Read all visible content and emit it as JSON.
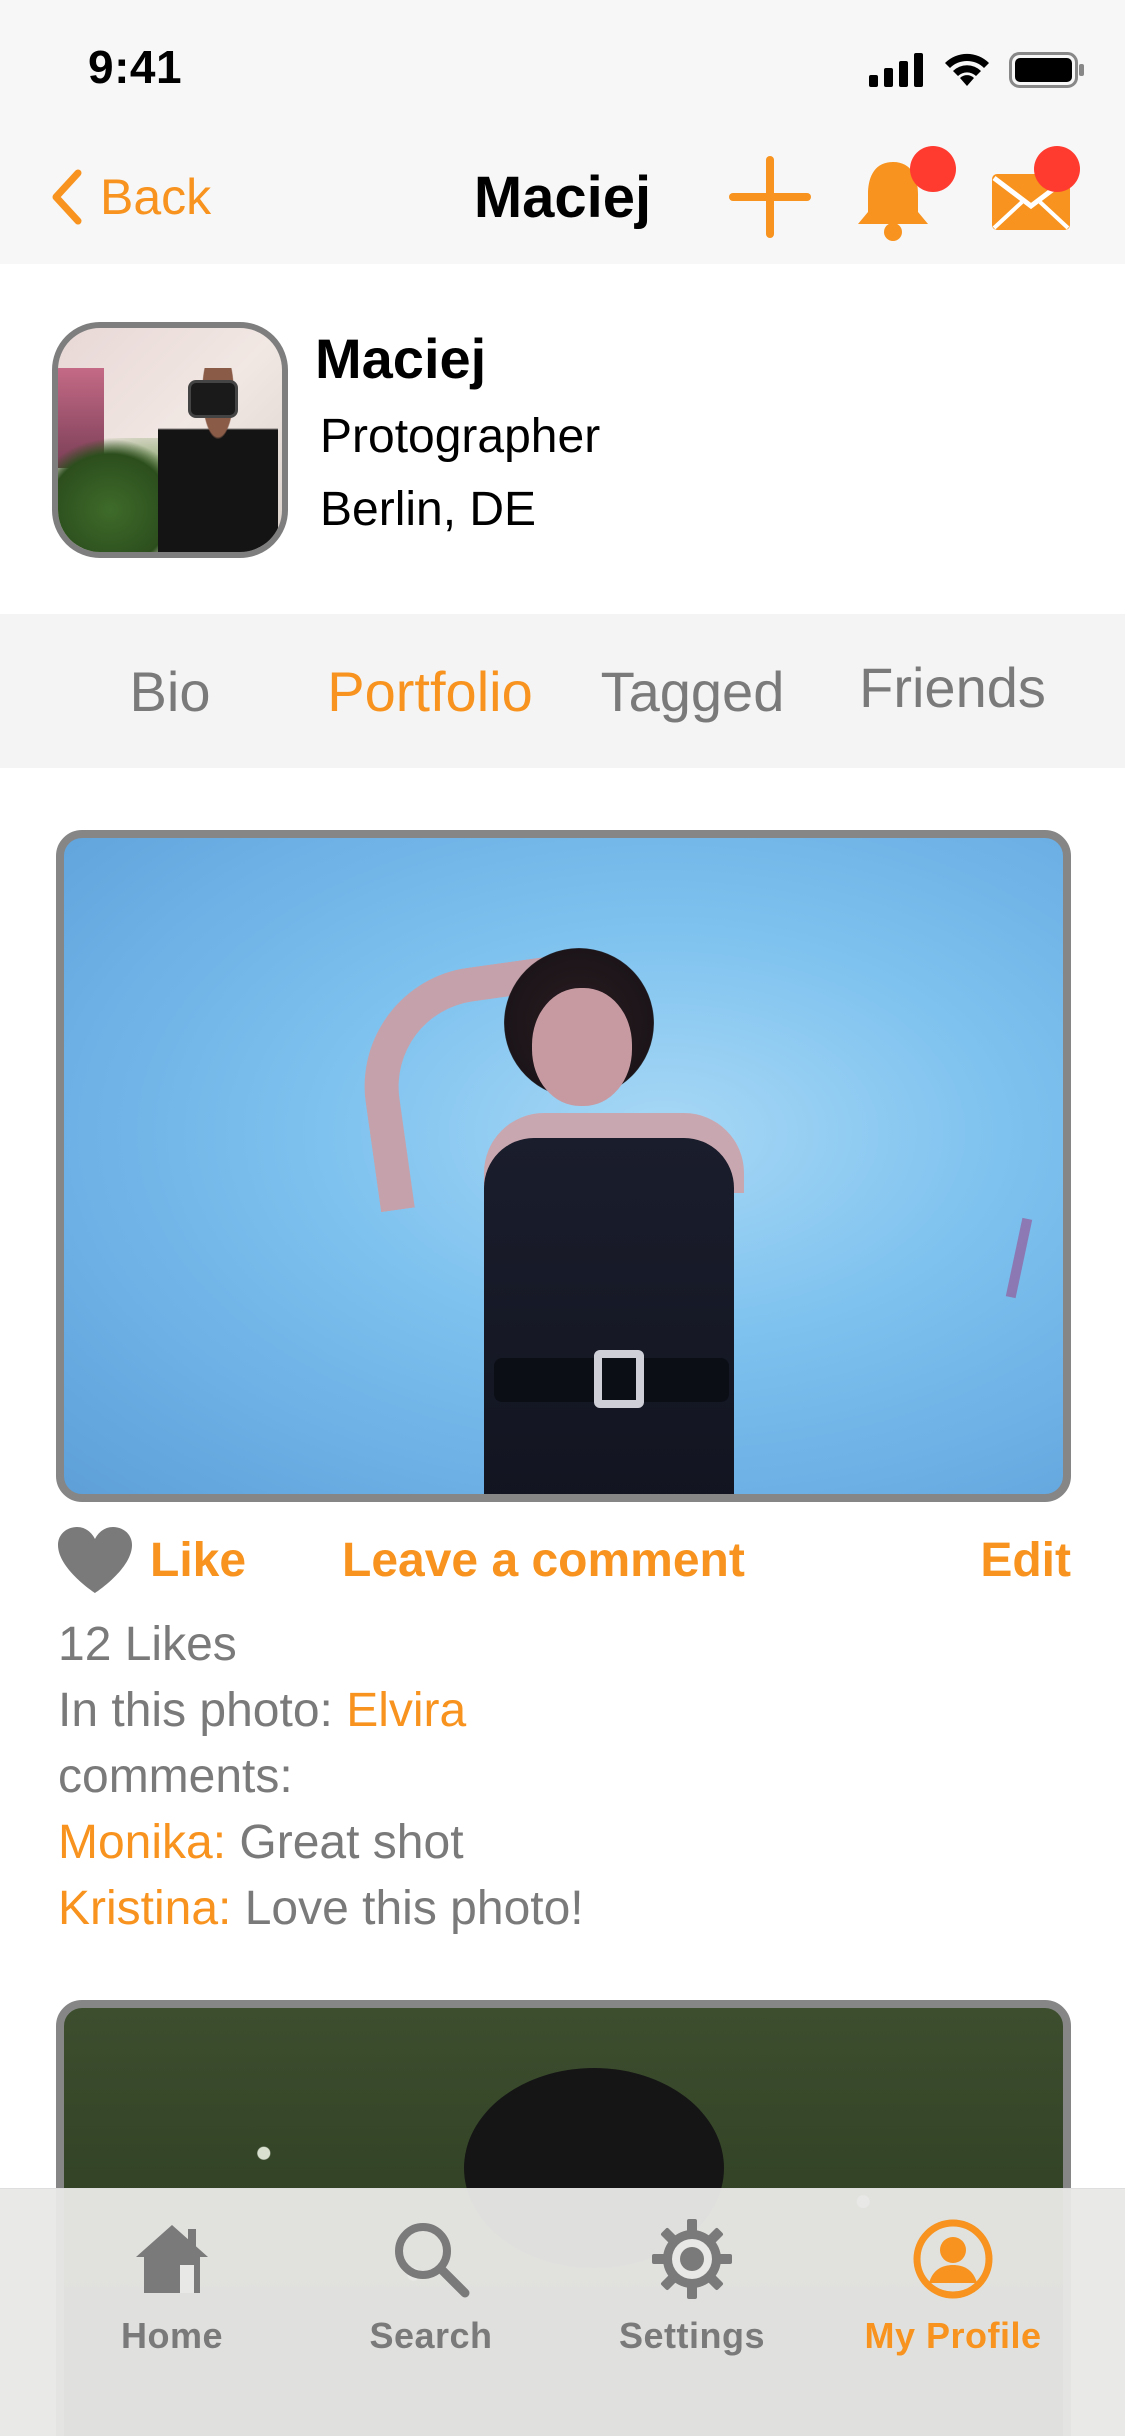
{
  "status_bar": {
    "time": "9:41"
  },
  "nav": {
    "back_label": "Back",
    "title": "Maciej"
  },
  "profile": {
    "name": "Maciej",
    "role": "Protographer",
    "location": "Berlin, DE"
  },
  "tabs": [
    {
      "label": "Bio",
      "active": false
    },
    {
      "label": "Portfolio",
      "active": true
    },
    {
      "label": "Tagged",
      "active": false
    },
    {
      "label": "Friends",
      "active": false
    }
  ],
  "post": {
    "like_label": "Like",
    "comment_label": "Leave a comment",
    "edit_label": "Edit",
    "likes_text": "12 Likes",
    "in_photo_prefix": "In this photo: ",
    "in_photo_name": "Elvira",
    "comments_heading": "comments:",
    "comments": [
      {
        "author": "Monika:",
        "text": " Great shot"
      },
      {
        "author": "Kristina:",
        "text": " Love this photo!"
      }
    ]
  },
  "tab_bar": {
    "items": [
      {
        "label": "Home",
        "icon": "home-icon",
        "active": false
      },
      {
        "label": "Search",
        "icon": "search-icon",
        "active": false
      },
      {
        "label": "Settings",
        "icon": "gear-icon",
        "active": false
      },
      {
        "label": "My Profile",
        "icon": "profile-icon",
        "active": true
      }
    ]
  },
  "colors": {
    "accent": "#f7931e",
    "badge": "#ff3b30",
    "muted": "#7a7a7a"
  }
}
